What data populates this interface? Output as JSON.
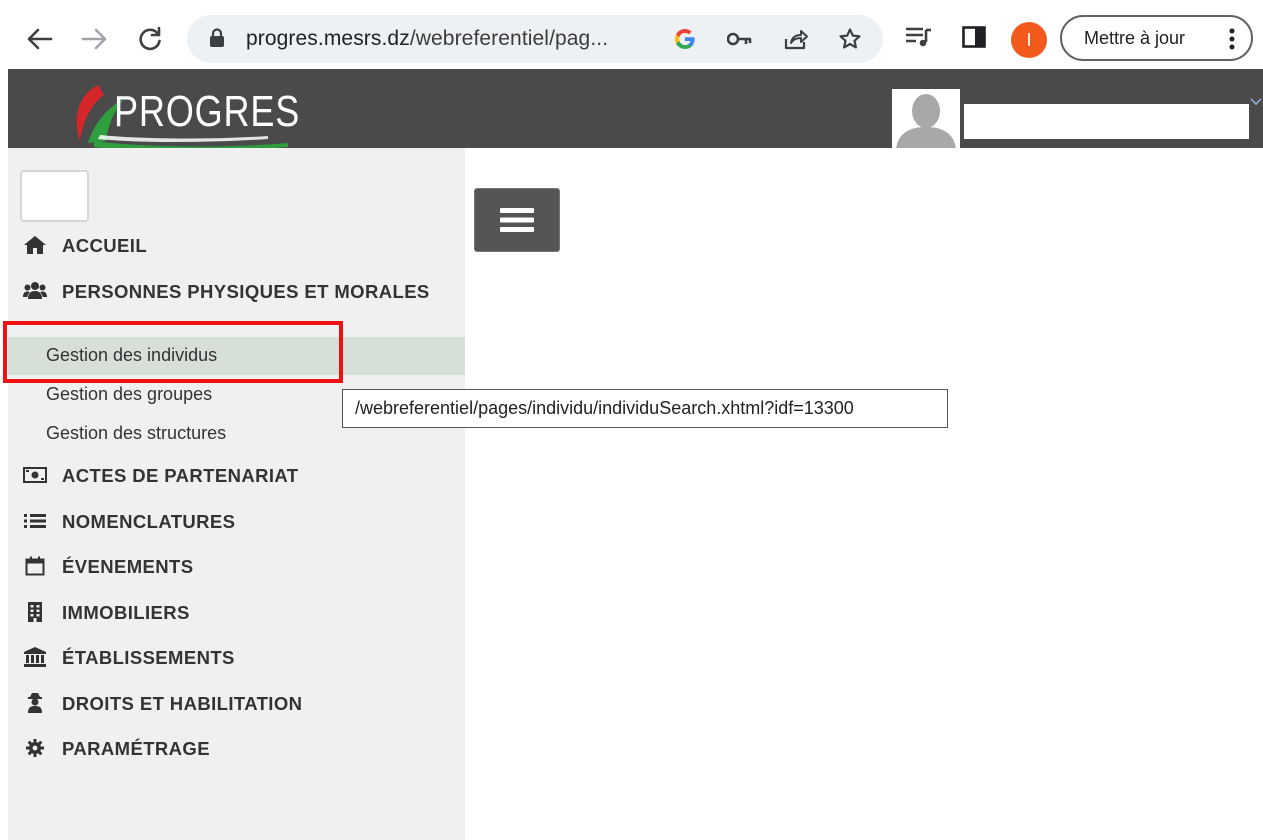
{
  "browser": {
    "url_host": "progres.mesrs.dz",
    "url_path": "/webreferentiel/pag...",
    "profile_initial": "I",
    "update_label": "Mettre à jour",
    "icons": [
      "back-arrow-icon",
      "forward-arrow-icon",
      "reload-icon",
      "lock-icon",
      "google-icon",
      "key-icon",
      "share-icon",
      "star-icon",
      "media-queue-icon",
      "side-panel-icon",
      "more-vert-icon"
    ]
  },
  "header": {
    "logo_text": "PROGRES",
    "brand_colors": {
      "red": "#d7262a",
      "green": "#2e9e3e"
    }
  },
  "sidebar": {
    "items": [
      {
        "label": "ACCUEIL",
        "icon": "home-icon"
      },
      {
        "label": "PERSONNES PHYSIQUES ET MORALES",
        "icon": "users-icon",
        "children": [
          {
            "label": "Gestion des individus",
            "active": true
          },
          {
            "label": "Gestion des groupes"
          },
          {
            "label": "Gestion des structures"
          }
        ]
      },
      {
        "label": "ACTES DE PARTENARIAT",
        "icon": "money-icon"
      },
      {
        "label": "NOMENCLATURES",
        "icon": "list-icon"
      },
      {
        "label": "ÉVENEMENTS",
        "icon": "calendar-icon"
      },
      {
        "label": "IMMOBILIERS",
        "icon": "building-icon"
      },
      {
        "label": "ÉTABLISSEMENTS",
        "icon": "institution-icon"
      },
      {
        "label": "DROITS ET HABILITATION",
        "icon": "user-secret-icon"
      },
      {
        "label": "PARAMÉTRAGE",
        "icon": "cog-icon"
      }
    ]
  },
  "main": {
    "toggle_icon": "hamburger-menu-icon"
  },
  "tooltip": {
    "text": "/webreferentiel/pages/individu/individuSearch.xhtml?idf=13300"
  },
  "annotation": {
    "highlight_color": "#ee1111"
  }
}
